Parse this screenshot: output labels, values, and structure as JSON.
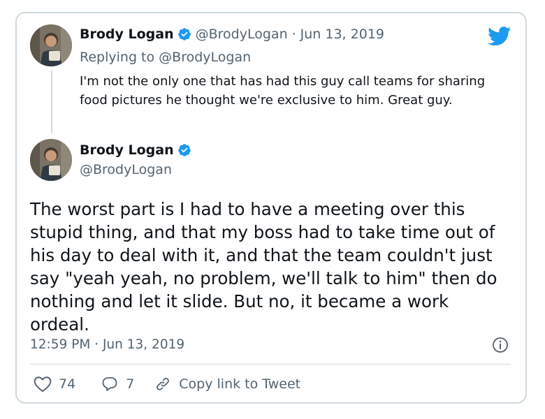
{
  "colors": {
    "twitter_blue": "#1d9bf0",
    "text_primary": "#0f1419",
    "text_secondary": "#536471",
    "border": "#cfd9de"
  },
  "icons": {
    "verified": "verified-badge-icon",
    "brand": "twitter-bird-icon",
    "info": "info-icon",
    "like": "heart-icon",
    "reply": "reply-bubble-icon",
    "link": "link-icon"
  },
  "parent_tweet": {
    "author_name": "Brody Logan",
    "author_handle": "@BrodyLogan",
    "separator": "·",
    "date": "Jun 13, 2019",
    "replying_prefix": "Replying to",
    "replying_to": "@BrodyLogan",
    "text": "I'm not the only one that has had this guy call teams for sharing food pictures he thought we're exclusive to him. Great guy."
  },
  "main_tweet": {
    "author_name": "Brody Logan",
    "author_handle": "@BrodyLogan",
    "text": "The worst part is I had to have a meeting over this stupid thing, and that my boss had to take time out of his day to deal with it, and that the team couldn't just say \"yeah yeah, no problem, we'll talk to him\" then do nothing and let it slide. But no, it became a work ordeal.",
    "timestamp": "12:59 PM · Jun 13, 2019"
  },
  "actions": {
    "likes": "74",
    "replies": "7",
    "copy_link_label": "Copy link to Tweet"
  }
}
